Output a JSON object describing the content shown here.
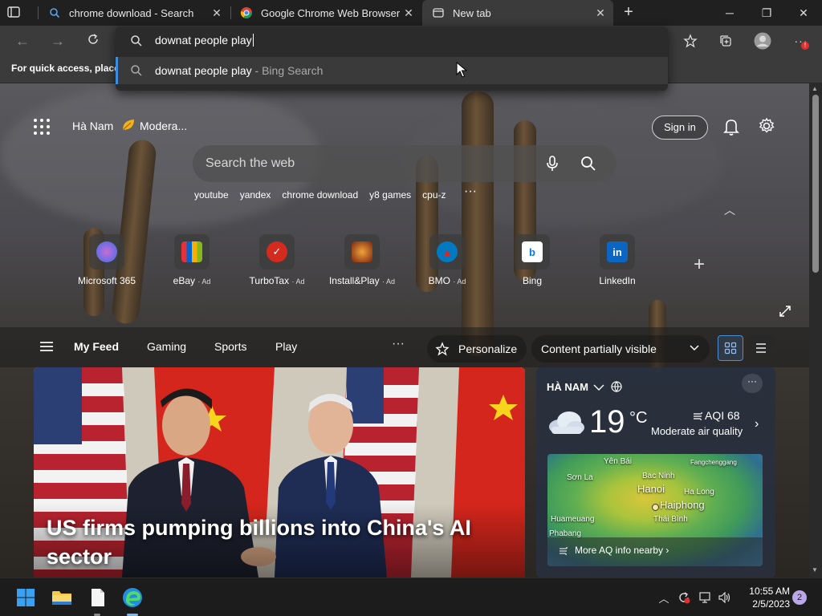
{
  "tabs": [
    {
      "title": "chrome download - Search",
      "active": false
    },
    {
      "title": "Google Chrome Web Browser",
      "active": false
    },
    {
      "title": "New tab",
      "active": true
    }
  ],
  "window_controls": {
    "minimize": "─",
    "restore": "❐",
    "close": "✕"
  },
  "omnibox": {
    "input_value": "downat people play",
    "suggestion_main": "downat people play",
    "suggestion_sub": " - Bing Search"
  },
  "favorites_bar": {
    "text": "For quick access, place y"
  },
  "header": {
    "location": "Hà Nam",
    "weather_short": "Modera...",
    "signin_label": "Sign in"
  },
  "search": {
    "placeholder": "Search the web",
    "suggestions": [
      "youtube",
      "yandex",
      "chrome download",
      "y8 games",
      "cpu-z"
    ],
    "more": "···"
  },
  "quick_links": [
    {
      "name": "Microsoft 365",
      "ad": "",
      "color": "#7b5cd6"
    },
    {
      "name": "eBay",
      "ad": "· Ad",
      "color": "#2b2b2b"
    },
    {
      "name": "TurboTax",
      "ad": "· Ad",
      "color": "#d52b1e"
    },
    {
      "name": "Install&Play",
      "ad": "· Ad",
      "color": "#a83a1a"
    },
    {
      "name": "BMO",
      "ad": "· Ad",
      "color": "#0079c1"
    },
    {
      "name": "Bing",
      "ad": "",
      "color": "#ffffff"
    },
    {
      "name": "LinkedIn",
      "ad": "",
      "color": "#0a66c2"
    }
  ],
  "feed": {
    "tabs": [
      "My Feed",
      "Gaming",
      "Sports",
      "Play"
    ],
    "more": "···",
    "personalize_label": "Personalize",
    "content_label": "Content partially visible"
  },
  "hero": {
    "title": "US firms pumping billions into China's AI sector"
  },
  "weather": {
    "location": "HÀ NAM",
    "temp": "19",
    "unit": "°C",
    "aqi": "AQI 68",
    "aqi_desc": "Moderate air quality",
    "map_labels": [
      "Yên Bái",
      "Fangchenggang",
      "Sơn La",
      "Bac Ninh",
      "Hanoi",
      "Ha Long",
      "Haiphong",
      "Huameuang",
      "Thái Bình",
      "Phabang"
    ],
    "more_aq": "More AQ info nearby"
  },
  "taskbar": {
    "time": "10:55 AM",
    "date": "2/5/2023",
    "notification_count": "2"
  },
  "colors": {
    "accent": "#3b8ee0",
    "chrome_bg": "#3b3b3b",
    "tab_bg": "#202020"
  }
}
